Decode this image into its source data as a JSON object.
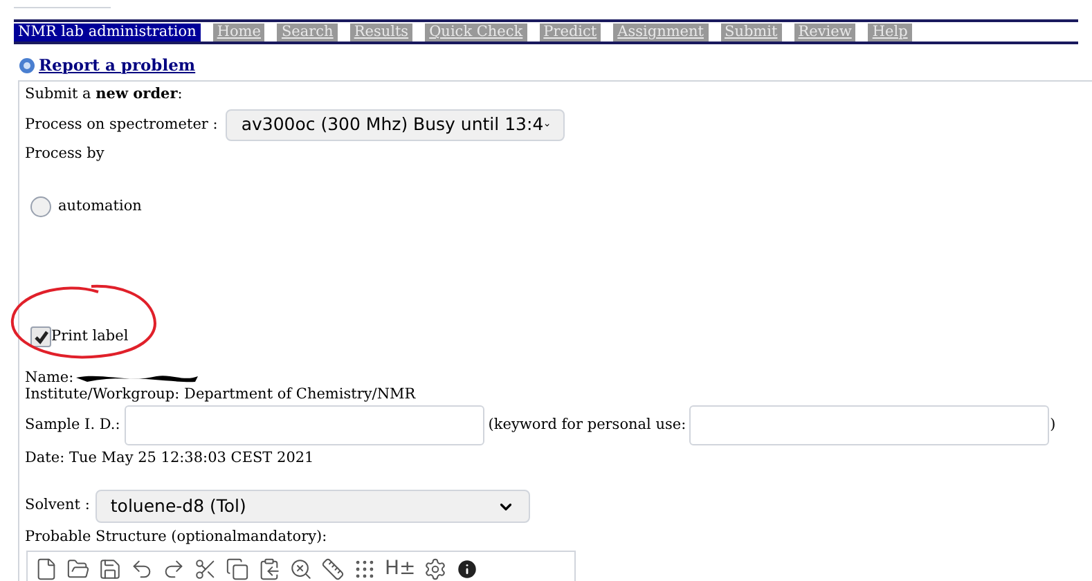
{
  "nav": {
    "tabs": [
      {
        "label": "NMR lab administration",
        "selected": true
      },
      {
        "label": "Home",
        "selected": false
      },
      {
        "label": "Search",
        "selected": false
      },
      {
        "label": "Results",
        "selected": false
      },
      {
        "label": "Quick Check",
        "selected": false
      },
      {
        "label": "Predict",
        "selected": false
      },
      {
        "label": "Assignment",
        "selected": false
      },
      {
        "label": "Submit",
        "selected": false
      },
      {
        "label": "Review",
        "selected": false
      },
      {
        "label": "Help",
        "selected": false
      }
    ]
  },
  "report_link": "Report a problem",
  "form": {
    "heading": "Submit a **new order**:",
    "spectrometer": {
      "label": "Process on spectrometer :",
      "value": "av300oc (300 Mhz) Busy until 13:4"
    },
    "process_by": {
      "label": "Process by",
      "options": [
        {
          "label": "automation",
          "selected": false
        }
      ]
    },
    "print_label": {
      "label": "Print label",
      "checked": true
    },
    "name_label": "Name:",
    "institute": "Institute/Workgroup: Department of Chemistry/NMR",
    "sample_id": {
      "label": "Sample I. D.:"
    },
    "keyword": {
      "label": "(keyword for personal use:",
      "closing": ")"
    },
    "date": "Date: Tue May 25 12:38:03 CEST 2021",
    "solvent": {
      "label": "Solvent :",
      "value": "toluene-d8 (Tol)"
    },
    "structure_label": "Probable Structure (optionalmandatory):",
    "editor_toolbar": {
      "hydrogen_button": "H±"
    }
  }
}
